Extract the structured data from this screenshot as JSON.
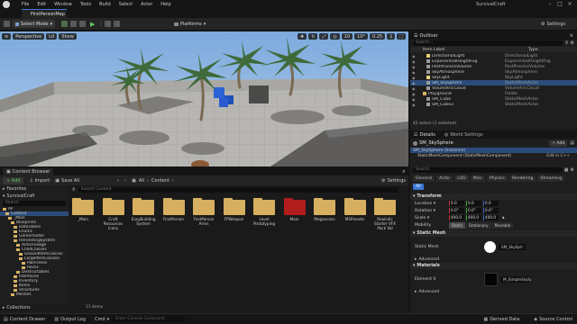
{
  "menu": {
    "items": [
      "File",
      "Edit",
      "Window",
      "Tools",
      "Build",
      "Select",
      "Actor",
      "Help"
    ],
    "project_title": "SurvivalCraft"
  },
  "tab": {
    "title": "FirstPersonMap"
  },
  "toolbar": {
    "select_mode": "Select Mode",
    "platforms": "Platforms",
    "settings": "Settings"
  },
  "viewport": {
    "buttons": [
      "Perspective",
      "Lit",
      "Show"
    ],
    "snap_value": "10",
    "angle_value": "10°",
    "scale_value": "0.25",
    "cam_value": "1"
  },
  "outliner": {
    "title": "Outliner",
    "search_placeholder": "Search...",
    "col_label": "Item Label",
    "col_type": "Type",
    "rows": [
      {
        "label": "DirectionalLight",
        "type": "DirectionalLight",
        "indent": 2,
        "selected": false,
        "kind": "light"
      },
      {
        "label": "ExponentialHeightFog",
        "type": "ExponentialHeightFog",
        "indent": 2,
        "selected": false,
        "kind": "actor"
      },
      {
        "label": "PostProcessVolume",
        "type": "PostProcessVolume",
        "indent": 2,
        "selected": false,
        "kind": "actor"
      },
      {
        "label": "SkyAtmosphere",
        "type": "SkyAtmosphere",
        "indent": 2,
        "selected": false,
        "kind": "actor"
      },
      {
        "label": "SkyLight",
        "type": "SkyLight",
        "indent": 2,
        "selected": false,
        "kind": "light"
      },
      {
        "label": "SM_SkySphere",
        "type": "StaticMeshActor",
        "indent": 2,
        "selected": true,
        "kind": "actor"
      },
      {
        "label": "VolumetricCloud",
        "type": "VolumetricCloud",
        "indent": 2,
        "selected": false,
        "kind": "actor"
      },
      {
        "label": "Playground",
        "type": "Folder",
        "indent": 1,
        "selected": false,
        "kind": "folder"
      },
      {
        "label": "SM_Cube",
        "type": "StaticMeshActor",
        "indent": 2,
        "selected": false,
        "kind": "actor"
      },
      {
        "label": "SM_Cube3",
        "type": "StaticMeshActor",
        "indent": 2,
        "selected": false,
        "kind": "actor"
      }
    ],
    "footer": "42 actors (1 selected)"
  },
  "details": {
    "tab_details": "Details",
    "tab_world": "World Settings",
    "actor_name": "SM_SkySphere",
    "add_label": "+ Add",
    "instance_row": "SM_SkySphere (Instance)",
    "component_row": "StaticMeshComponent (StaticMeshComponent)",
    "edit_in": "Edit in C++",
    "search_placeholder": "Search",
    "filter_tabs": [
      "General",
      "Actor",
      "LOD",
      "Misc",
      "Physics",
      "Rendering",
      "Streaming"
    ],
    "all_tab": "All",
    "transform_title": "Transform",
    "location_label": "Location",
    "location": [
      "0.0",
      "0.0",
      "0.0"
    ],
    "rotation_label": "Rotation",
    "rotation": [
      "0.0°",
      "0.0°",
      "0.0°"
    ],
    "scale_label": "Scale",
    "scale": [
      "400.0",
      "400.0",
      "400.0"
    ],
    "mobility_label": "Mobility",
    "mobility": [
      "Static",
      "Stationary",
      "Movable"
    ],
    "mobility_active": "Static",
    "static_mesh_title": "Static Mesh",
    "static_mesh_label": "Static Mesh",
    "static_mesh_value": "SM_SkySph",
    "advanced1": "Advanced",
    "materials_title": "Materials",
    "element_label": "Element 0",
    "material_value": "M_SimpleSkySph",
    "advanced2": "Advanced"
  },
  "content": {
    "tab_label": "Content Browser",
    "add_label": "+ Add",
    "import_label": "Import",
    "save_all_label": "Save All",
    "breadcrumb": [
      "All",
      "Content"
    ],
    "settings_label": "Settings",
    "favorites_label": "Favorites",
    "project_label": "SurvivalCraft",
    "search_placeholder": "Search Content",
    "search_tree_placeholder": "Search",
    "collections_label": "Collections",
    "item_count": "11 items",
    "tree": [
      {
        "label": "All",
        "indent": 0,
        "selected": false
      },
      {
        "label": "Content",
        "indent": 1,
        "selected": true
      },
      {
        "label": "_Main",
        "indent": 2,
        "selected": false
      },
      {
        "label": "Blueprints",
        "indent": 3,
        "selected": false
      },
      {
        "label": "DataTables",
        "indent": 4,
        "selected": false
      },
      {
        "label": "Enums",
        "indent": 4,
        "selected": false
      },
      {
        "label": "Gamemodes",
        "indent": 4,
        "selected": false
      },
      {
        "label": "HarvestingSystem",
        "indent": 4,
        "selected": false
      },
      {
        "label": "ActorFoliage",
        "indent": 5,
        "selected": false
      },
      {
        "label": "ChildClasses",
        "indent": 5,
        "selected": false
      },
      {
        "label": "GroundItemClasses",
        "indent": 6,
        "selected": false
      },
      {
        "label": "LargeItemClasses",
        "indent": 6,
        "selected": false
      },
      {
        "label": "PalmTrees",
        "indent": 7,
        "selected": false
      },
      {
        "label": "Rocks",
        "indent": 7,
        "selected": false
      },
      {
        "label": "Destructables",
        "indent": 5,
        "selected": false
      },
      {
        "label": "Interfaces",
        "indent": 4,
        "selected": false
      },
      {
        "label": "Inventory",
        "indent": 4,
        "selected": false
      },
      {
        "label": "Items",
        "indent": 4,
        "selected": false
      },
      {
        "label": "Structures",
        "indent": 4,
        "selected": false
      },
      {
        "label": "Meshes",
        "indent": 3,
        "selected": false
      }
    ],
    "folders": [
      {
        "label": "_Main",
        "color": "#d6b060"
      },
      {
        "label": "Craft Resources Icons",
        "color": "#d6b060"
      },
      {
        "label": "EasyBuilding System",
        "color": "#d6b060"
      },
      {
        "label": "FirstPerson",
        "color": "#d6b060"
      },
      {
        "label": "FirstPerson Arms",
        "color": "#d6b060"
      },
      {
        "label": "FPWeapon",
        "color": "#d6b060"
      },
      {
        "label": "Level Prototyping",
        "color": "#d6b060"
      },
      {
        "label": "Main",
        "color": "#b11c1c"
      },
      {
        "label": "Megascans",
        "color": "#d6b060"
      },
      {
        "label": "MSPresets",
        "color": "#d6b060"
      },
      {
        "label": "Realistic Starter VFX Pack Vol",
        "color": "#d6b060"
      }
    ]
  },
  "status": {
    "content_drawer": "Content Drawer",
    "output_log": "Output Log",
    "cmd": "Cmd",
    "console_placeholder": "Enter Console Command",
    "derived_data": "Derived Data",
    "source_control": "Source Control"
  },
  "colors": {
    "accent": "#3a78d4",
    "selected_row": "#2b4c7a",
    "folder": "#d6b060",
    "folder_red": "#b11c1c"
  }
}
